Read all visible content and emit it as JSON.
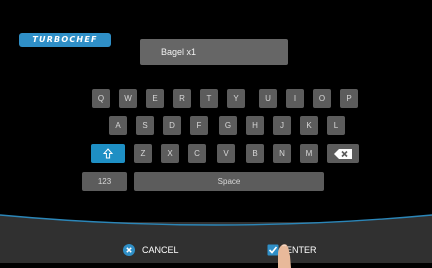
{
  "brand": {
    "logo_text": "TURBOCHEF",
    "accent": "#2f8fc7"
  },
  "entry": {
    "value": "Bagel x1"
  },
  "keyboard": {
    "row1": [
      "Q",
      "W",
      "E",
      "R",
      "T",
      "Y",
      "U",
      "I",
      "O",
      "P"
    ],
    "row2": [
      "A",
      "S",
      "D",
      "F",
      "G",
      "H",
      "J",
      "K",
      "L"
    ],
    "row3": [
      "Z",
      "X",
      "C",
      "V",
      "B",
      "N",
      "M"
    ],
    "shift_icon": "shift-arrow-icon",
    "backspace_icon": "backspace-icon",
    "numbers_label": "123",
    "space_label": "Space"
  },
  "footer": {
    "cancel_label": "CANCEL",
    "cancel_icon": "close-circle-icon",
    "enter_label": "ENTER",
    "enter_icon": "checkbox-check-icon"
  },
  "colors": {
    "key_bg": "#5c5c5c",
    "shift_active": "#1e8fc4",
    "bar_bg": "#303030"
  }
}
